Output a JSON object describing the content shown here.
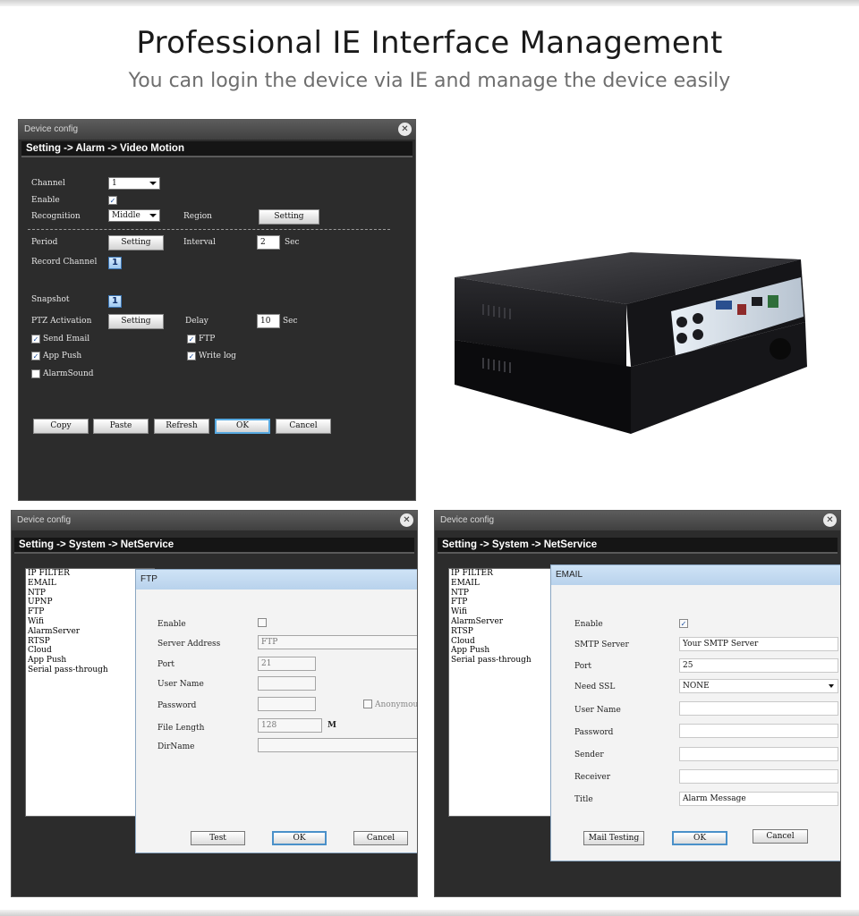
{
  "header": {
    "title": "Professional IE Interface Management",
    "subtitle": "You can login the device via IE and manage the device easily"
  },
  "motion_dialog": {
    "window_title": "Device config",
    "breadcrumb": "Setting -> Alarm -> Video Motion",
    "channel_label": "Channel",
    "channel_value": "1",
    "enable_label": "Enable",
    "enable_checked": true,
    "recognition_label": "Recognition",
    "recognition_value": "Middle",
    "region_label": "Region",
    "region_button": "Setting",
    "period_label": "Period",
    "period_button": "Setting",
    "interval_label": "Interval",
    "interval_value": "2",
    "interval_unit": "Sec",
    "record_channel_label": "Record Channel",
    "record_channel_value": "1",
    "snapshot_label": "Snapshot",
    "snapshot_value": "1",
    "ptz_label": "PTZ Activation",
    "ptz_button": "Setting",
    "delay_label": "Delay",
    "delay_value": "10",
    "delay_unit": "Sec",
    "send_email_label": "Send Email",
    "ftp_label": "FTP",
    "app_push_label": "App Push",
    "write_log_label": "Write log",
    "alarm_sound_label": "AlarmSound",
    "buttons": {
      "copy": "Copy",
      "paste": "Paste",
      "refresh": "Refresh",
      "ok": "OK",
      "cancel": "Cancel"
    }
  },
  "ftp_dialog": {
    "window_title": "Device config",
    "breadcrumb": "Setting -> System -> NetService",
    "services": [
      "IP FILTER",
      "EMAIL",
      "NTP",
      "UPNP",
      "FTP",
      "Wifi",
      "AlarmServer",
      "RTSP",
      "Cloud",
      "App Push",
      "Serial pass-through"
    ],
    "panel_title": "FTP",
    "enable_label": "Enable",
    "server_address_label": "Server Address",
    "server_address_value": "FTP",
    "port_label": "Port",
    "port_value": "21",
    "user_name_label": "User Name",
    "password_label": "Password",
    "anonymous_label": "Anonymous",
    "file_length_label": "File Length",
    "file_length_value": "128",
    "file_length_unit": "M",
    "dirname_label": "DirName",
    "buttons": {
      "test": "Test",
      "ok": "OK",
      "cancel": "Cancel"
    }
  },
  "email_dialog": {
    "window_title": "Device config",
    "breadcrumb": "Setting -> System -> NetService",
    "services": [
      "IP FILTER",
      "EMAIL",
      "NTP",
      "FTP",
      "Wifi",
      "AlarmServer",
      "RTSP",
      "Cloud",
      "App Push",
      "Serial pass-through"
    ],
    "panel_title": "EMAIL",
    "enable_label": "Enable",
    "smtp_label": "SMTP Server",
    "smtp_value": "Your SMTP Server",
    "port_label": "Port",
    "port_value": "25",
    "ssl_label": "Need SSL",
    "ssl_value": "NONE",
    "user_name_label": "User Name",
    "password_label": "Password",
    "sender_label": "Sender",
    "receiver_label": "Receiver",
    "title_label": "Title",
    "title_value": "Alarm Message",
    "buttons": {
      "mail_testing": "Mail Testing",
      "ok": "OK",
      "cancel": "Cancel"
    }
  },
  "colors": {
    "accent": "#57a9e0",
    "window_bg": "#2c2c2c",
    "panel_bg": "#f3f3f3"
  }
}
